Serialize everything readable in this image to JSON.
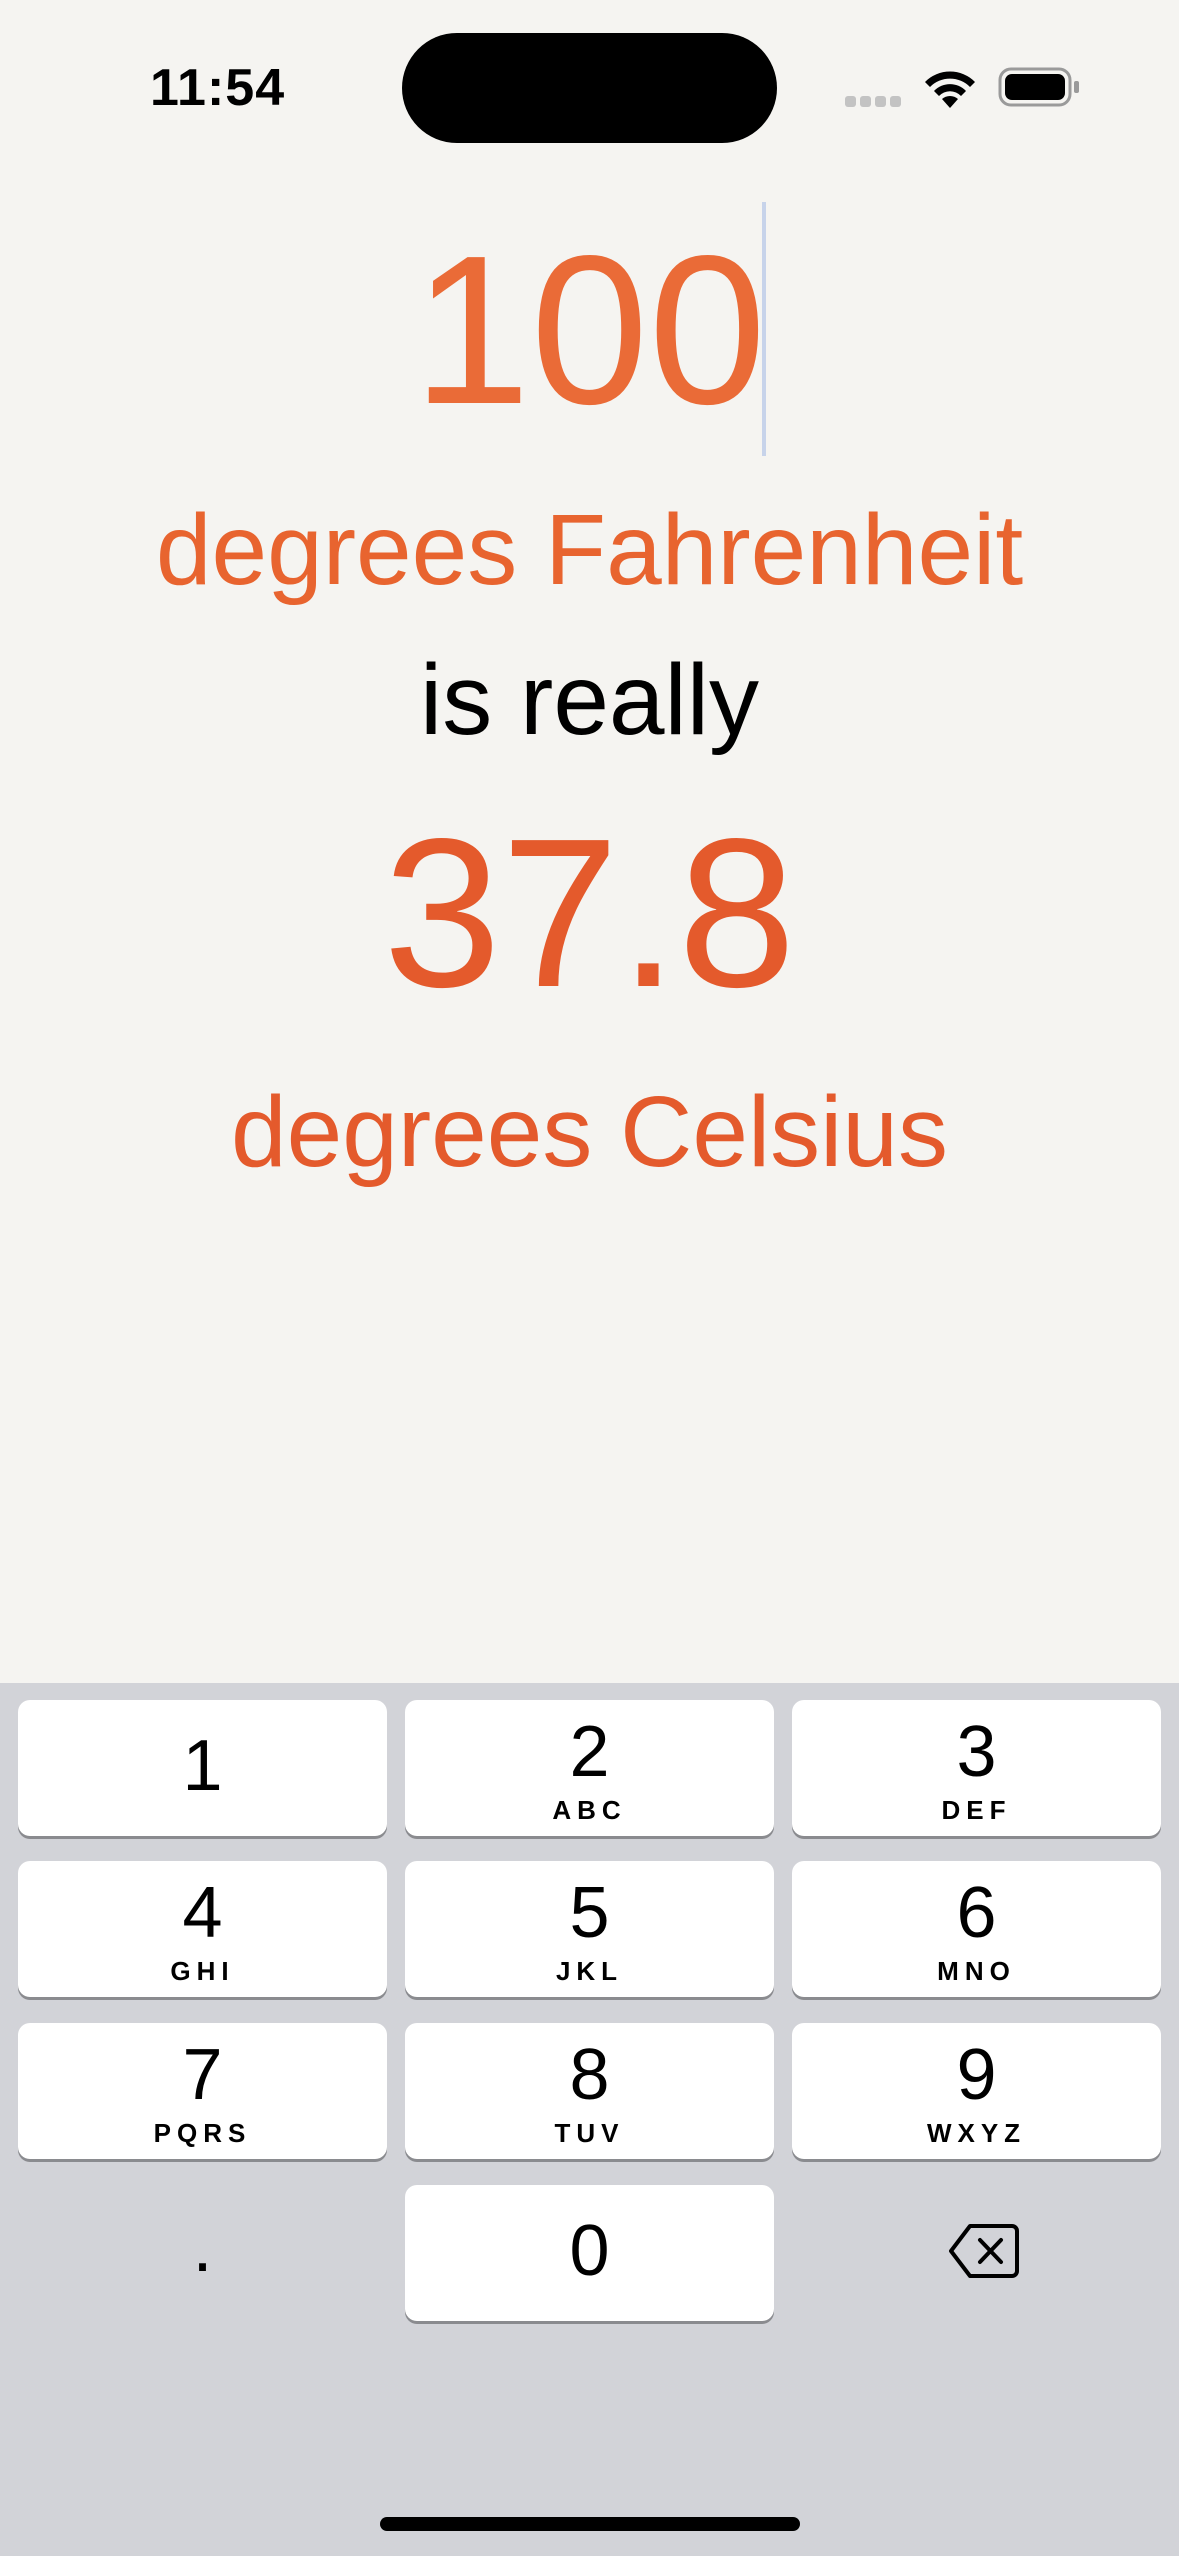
{
  "status_bar": {
    "time": "11:54"
  },
  "converter": {
    "input_value": "100",
    "input_unit": "degrees Fahrenheit",
    "connector": "is really",
    "output_value": "37.8",
    "output_unit": "degrees Celsius"
  },
  "keypad": {
    "keys": [
      {
        "digit": "1",
        "letters": ""
      },
      {
        "digit": "2",
        "letters": "ABC"
      },
      {
        "digit": "3",
        "letters": "DEF"
      },
      {
        "digit": "4",
        "letters": "GHI"
      },
      {
        "digit": "5",
        "letters": "JKL"
      },
      {
        "digit": "6",
        "letters": "MNO"
      },
      {
        "digit": "7",
        "letters": "PQRS"
      },
      {
        "digit": "8",
        "letters": "TUV"
      },
      {
        "digit": "9",
        "letters": "WXYZ"
      },
      {
        "digit": "0",
        "letters": ""
      }
    ],
    "decimal_key": ".",
    "delete_icon": "delete-backward-icon"
  },
  "colors": {
    "background": "#f5f4f1",
    "accent": "#e8642f",
    "keyboard_bg": "#d2d3d8",
    "key_bg": "#ffffff"
  }
}
